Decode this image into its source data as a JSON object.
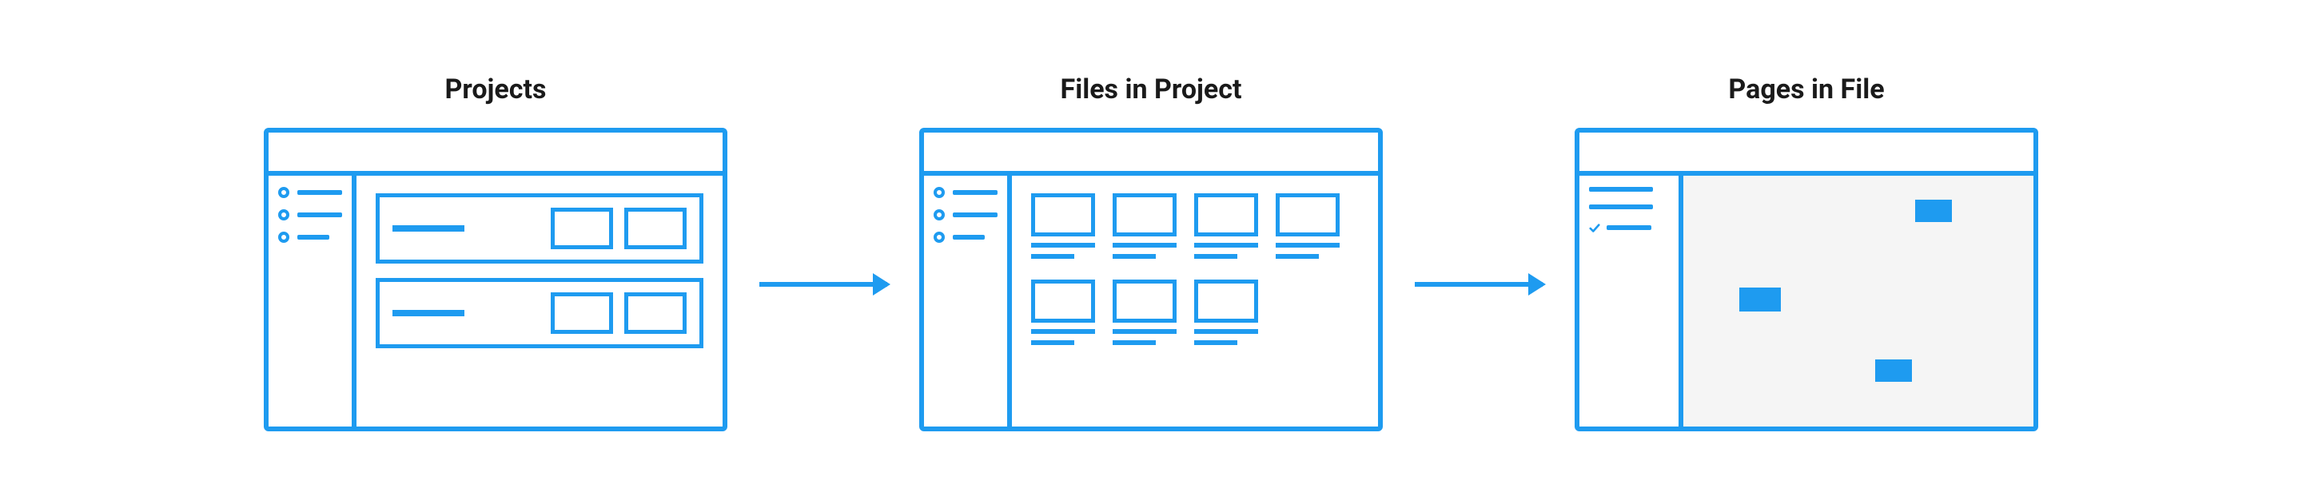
{
  "labels": {
    "projects": "Projects",
    "files": "Files in Project",
    "pages": "Pages in File"
  },
  "color": "#1E9BF0"
}
